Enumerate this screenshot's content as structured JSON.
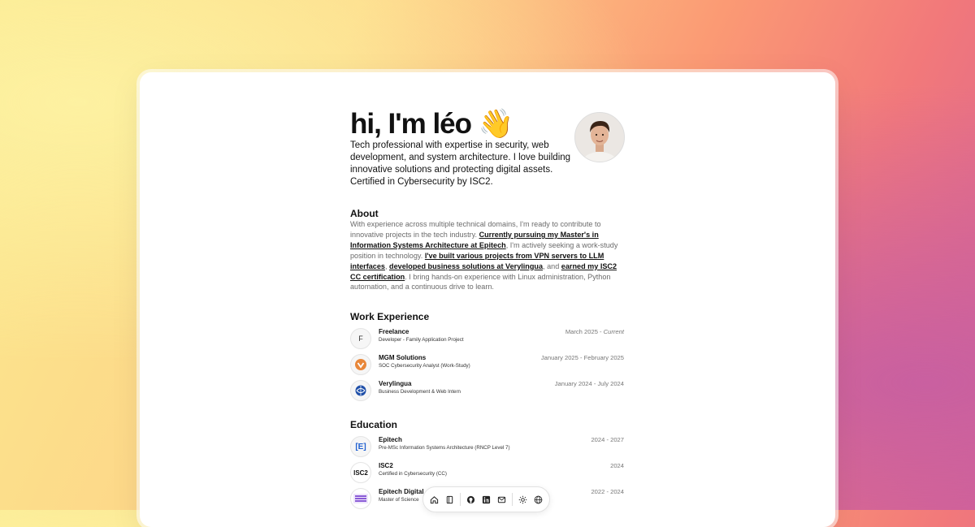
{
  "hero": {
    "title": "hi, I'm léo 👋",
    "description": "Tech professional with expertise in security, web development, and system architecture. I love building innovative solutions and protecting digital assets. Certified in Cybersecurity by ISC2."
  },
  "about": {
    "heading": "About",
    "text_1": "With experience across multiple technical domains, I'm ready to contribute to innovative projects in the tech industry. ",
    "link_1": "Currently pursuing my Master's in Information Systems Architecture at Epitech",
    "text_2": ", I'm actively seeking a work-study position in technology. ",
    "link_2": "I've built various projects from VPN servers to LLM interfaces",
    "text_3": ", ",
    "link_3": "developed business solutions at Verylingua",
    "text_4": ", and ",
    "link_4": "earned my ISC2 CC certification",
    "text_5": ". I bring hands-on experience with Linux administration, Python automation, and a continuous drive to learn."
  },
  "work": {
    "heading": "Work Experience",
    "items": [
      {
        "logo": "F",
        "name": "Freelance",
        "role": "Developer - Family Application Project",
        "date": "March 2025 - ",
        "date_current": "Current"
      },
      {
        "logo": "mgm-logo",
        "name": "MGM Solutions",
        "role": "SOC Cybersecurity Analyst (Work-Study)",
        "date": "January 2025 - February 2025"
      },
      {
        "logo": "verylingua-logo",
        "name": "Verylingua",
        "role": "Business Development & Web Intern",
        "date": "January 2024 - July 2024"
      }
    ]
  },
  "education": {
    "heading": "Education",
    "items": [
      {
        "logo": "[E]",
        "name": "Epitech",
        "role": "Pre-MSc Information Systems Architecture (RNCP Level 7)",
        "date": "2024 - 2027"
      },
      {
        "logo": "ISC2",
        "name": "ISC2",
        "role": "Certified in Cybersecurity (CC)",
        "date": "2024"
      },
      {
        "logo": "epitech-digital-logo",
        "name": "Epitech Digital",
        "role": "Master of Science",
        "date": "2022 - 2024"
      }
    ]
  },
  "dock": {
    "icons": [
      "home-icon",
      "notebook-icon",
      "github-icon",
      "linkedin-icon",
      "mail-icon",
      "sun-icon",
      "globe-icon"
    ]
  },
  "colors": {
    "mgm": "#e8873a",
    "verylingua": "#1f4fa8",
    "epitech": "#1f5fd0",
    "epitech_digital": "#8a5bd6"
  }
}
